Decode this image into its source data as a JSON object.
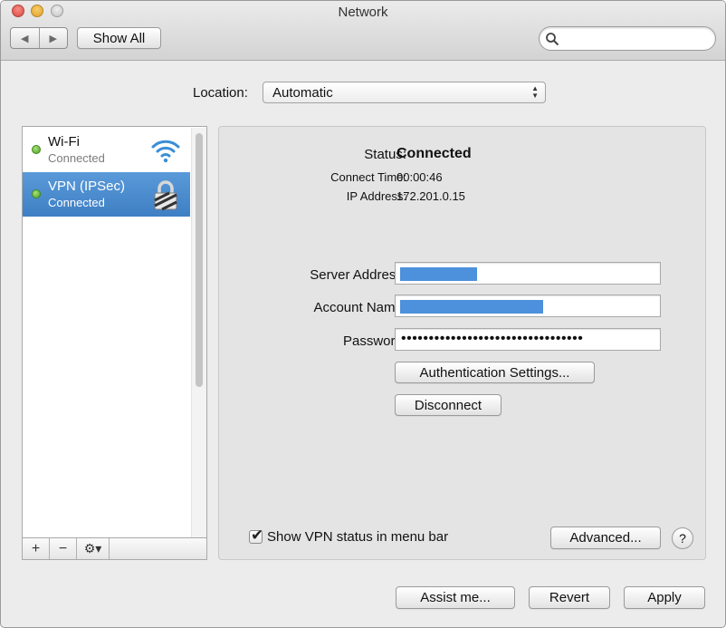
{
  "window": {
    "title": "Network"
  },
  "toolbar": {
    "back_glyph": "◀",
    "forward_glyph": "▶",
    "show_all_label": "Show All",
    "search_placeholder": ""
  },
  "location": {
    "label": "Location:",
    "value": "Automatic"
  },
  "services": [
    {
      "name": "Wi-Fi",
      "status": "Connected",
      "status_color": "#4ea221",
      "icon": "wifi-icon",
      "selected": false
    },
    {
      "name": "VPN (IPSec)",
      "status": "Connected",
      "status_color": "#4ea221",
      "icon": "vpn-lock-icon",
      "selected": true
    }
  ],
  "sidebar_controls": {
    "add": "+",
    "remove": "−",
    "gear": "⚙▾"
  },
  "detail": {
    "status_label": "Status:",
    "status_value": "Connected",
    "connect_time_label": "Connect Time:",
    "connect_time_value": "00:00:46",
    "ip_label": "IP Address:",
    "ip_value": "172.201.0.15",
    "server_label": "Server Address:",
    "account_label": "Account Name:",
    "password_label": "Password:",
    "password_dots": "•••••••••••••••••••••••••••••••••",
    "auth_settings_label": "Authentication Settings...",
    "disconnect_label": "Disconnect",
    "show_status_label": "Show VPN status in menu bar",
    "show_status_checked": true,
    "advanced_label": "Advanced...",
    "help_label": "?"
  },
  "footer": {
    "assist_label": "Assist me...",
    "revert_label": "Revert",
    "apply_label": "Apply"
  },
  "colors": {
    "selection": "#3e7fc4",
    "redaction": "#4d90db",
    "status_green": "#4ea221"
  }
}
